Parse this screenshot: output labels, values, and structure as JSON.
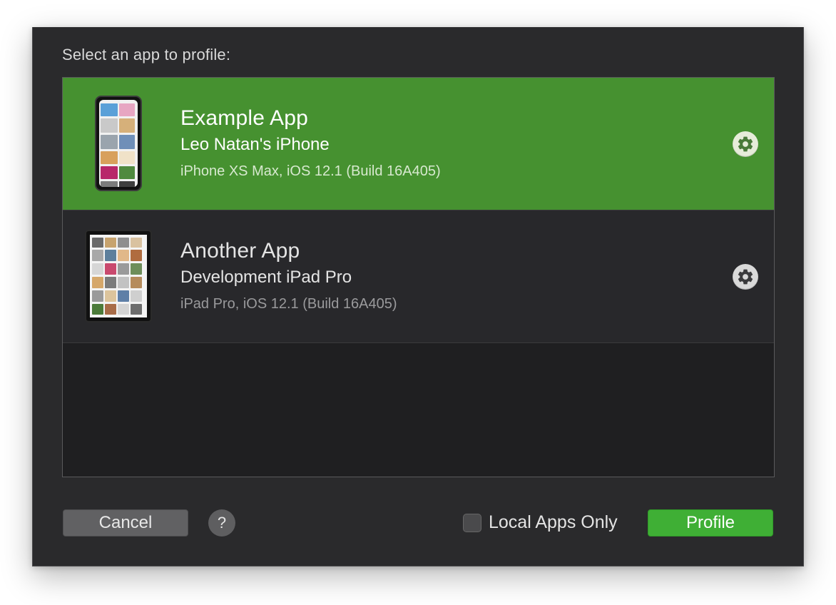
{
  "dialog": {
    "prompt": "Select an app to profile:"
  },
  "apps": [
    {
      "name": "Example App",
      "device": "Leo Natan's iPhone",
      "details": "iPhone XS Max, iOS 12.1 (Build 16A405)",
      "selected": true,
      "thumbnail": "iphone-screenshot"
    },
    {
      "name": "Another App",
      "device": "Development iPad Pro",
      "details": "iPad Pro, iOS 12.1 (Build 16A405)",
      "selected": false,
      "thumbnail": "ipad-screenshot"
    }
  ],
  "footer": {
    "cancel_label": "Cancel",
    "help_label": "?",
    "local_only_label": "Local Apps Only",
    "local_only_checked": false,
    "profile_label": "Profile"
  },
  "colors": {
    "selected_row": "#469130",
    "profile_button": "#3faf35",
    "sheet_background": "#2a2a2c"
  }
}
